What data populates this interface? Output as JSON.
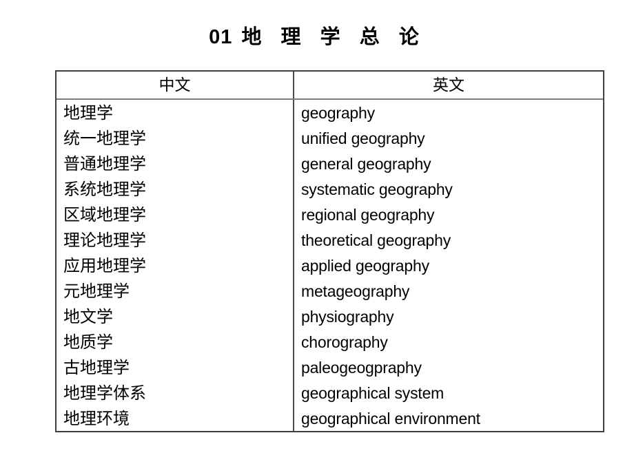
{
  "slide": {
    "title_number": "01",
    "title_text": "地 理 学 总 论",
    "background_color": "#ffffff",
    "text_color": "#000000",
    "border_color": "#3f3f3f",
    "header_rule_color": "#7a7a7a"
  },
  "table": {
    "headers": {
      "chinese": "中文",
      "english": "英文"
    },
    "rows": [
      {
        "chinese": "地理学",
        "english": "geography"
      },
      {
        "chinese": "统一地理学",
        "english": "unified geography"
      },
      {
        "chinese": "普通地理学",
        "english": "general geography"
      },
      {
        "chinese": "系统地理学",
        "english": "systematic geography"
      },
      {
        "chinese": "区域地理学",
        "english": "regional geography"
      },
      {
        "chinese": "理论地理学",
        "english": "theoretical geography"
      },
      {
        "chinese": "应用地理学",
        "english": "applied geography"
      },
      {
        "chinese": "元地理学",
        "english": "metageography"
      },
      {
        "chinese": "地文学",
        "english": "physiography"
      },
      {
        "chinese": "地质学",
        "english": "chorography"
      },
      {
        "chinese": "古地理学",
        "english": "paleogeogpraphy"
      },
      {
        "chinese": "地理学体系",
        "english": "geographical system"
      },
      {
        "chinese": "地理环境",
        "english": "geographical environment"
      }
    ]
  }
}
